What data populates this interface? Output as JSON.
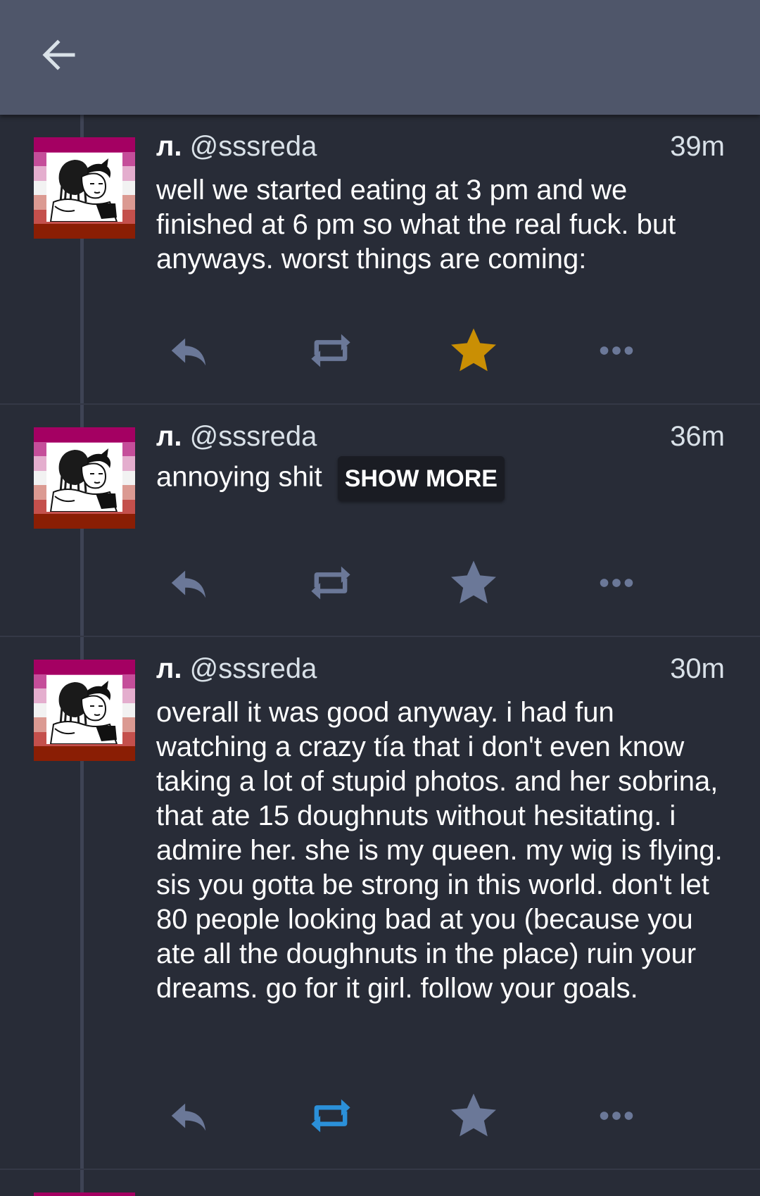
{
  "header": {
    "back_icon": "arrow-left-icon"
  },
  "colors": {
    "appbar": "#4f566a",
    "background": "#282c37",
    "action_icon": "#6b7898",
    "favourited": "#ca8f04",
    "boosted": "#2b90d9",
    "avatar_flag": [
      "#a40062",
      "#c54e9a",
      "#e4aece",
      "#f2f2f2",
      "#db9a92",
      "#c4504c",
      "#8a1e04"
    ]
  },
  "statuses": [
    {
      "display_name": "л.",
      "acct": "@sssreda",
      "time": "39m",
      "content": "well we started eating at 3 pm and we finished at 6 pm so what the real fuck. but anyways. worst things are coming:",
      "favourited": true,
      "boosted": false
    },
    {
      "display_name": "л.",
      "acct": "@sssreda",
      "time": "36m",
      "spoiler": "annoying shit",
      "show_more_label": "SHOW MORE",
      "favourited": false,
      "boosted": false
    },
    {
      "display_name": "л.",
      "acct": "@sssreda",
      "time": "30m",
      "content": "overall it was good anyway. i had fun watching a crazy tía that i don't even know taking a lot of stupid photos. and her sobrina, that ate 15 doughnuts without hesitating. i admire her. she is my queen. my wig is flying. sis you gotta be strong in this world. don't let 80 people looking bad at you (because you ate all the doughnuts in the place) ruin your dreams. go for it girl. follow your goals.",
      "favourited": false,
      "boosted": true
    }
  ],
  "action_icons": [
    "reply-icon",
    "boost-icon",
    "favourite-star-icon",
    "more-options-icon"
  ]
}
